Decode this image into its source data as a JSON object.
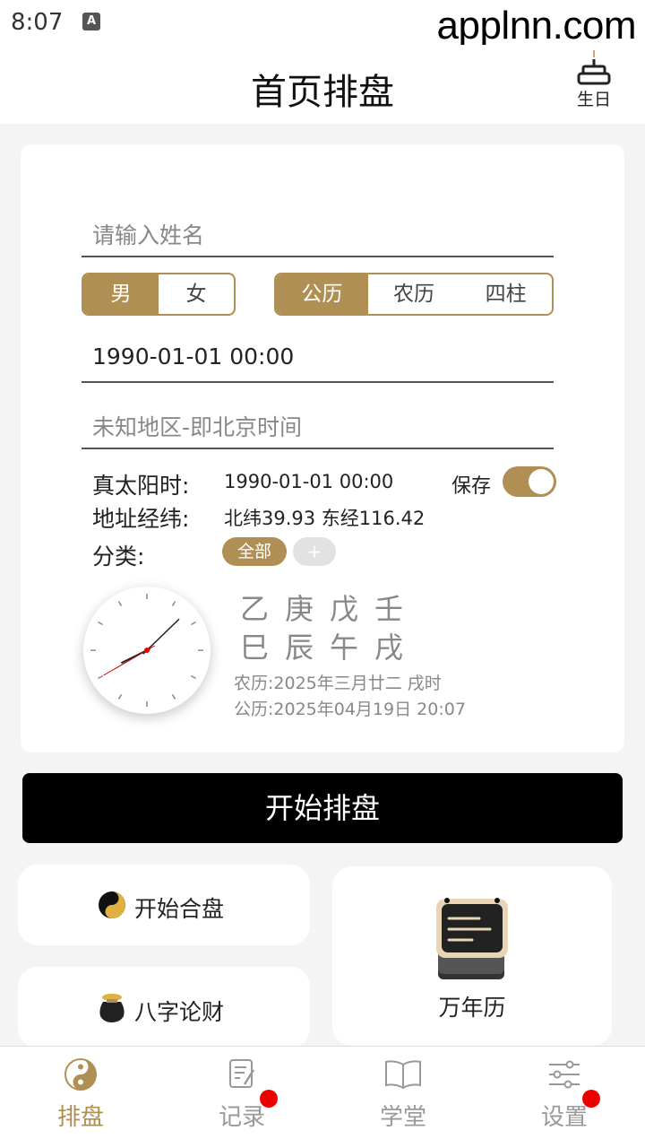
{
  "status": {
    "time": "8:07",
    "notification_icon": "A",
    "watermark": "applnn.com"
  },
  "header": {
    "title": "首页排盘",
    "birthday_label": "生日"
  },
  "form": {
    "name_placeholder": "请输入姓名",
    "gender": {
      "options": [
        "男",
        "女"
      ],
      "selected": "男"
    },
    "calendar": {
      "options": [
        "公历",
        "农历",
        "四柱"
      ],
      "selected": "公历"
    },
    "datetime_value": "1990-01-01 00:00",
    "location_placeholder": "未知地区-即北京时间"
  },
  "info": {
    "solar_time_label": "真太阳时:",
    "solar_time_value": "1990-01-01 00:00",
    "save_label": "保存",
    "save_on": true,
    "coords_label": "地址经纬:",
    "coords_value": "北纬39.93 东经116.42",
    "category_label": "分类:",
    "category_all": "全部",
    "category_add": "+"
  },
  "ganzhi": {
    "stems": "乙庚戊壬",
    "branches": "巳辰午戌",
    "lunar_line": "农历:2025年三月廿二 戌时",
    "solar_line": "公历:2025年04月19日 20:07"
  },
  "clock": {
    "hour": 20,
    "minute": 7,
    "second": 40
  },
  "start_button": "开始排盘",
  "features": {
    "hepan": "开始合盘",
    "lucai": "八字论财",
    "wannianli": "万年历"
  },
  "nav": {
    "items": [
      {
        "label": "排盘",
        "icon": "yinyang-icon",
        "badge": false
      },
      {
        "label": "记录",
        "icon": "notes-icon",
        "badge": true
      },
      {
        "label": "学堂",
        "icon": "book-icon",
        "badge": false
      },
      {
        "label": "设置",
        "icon": "sliders-icon",
        "badge": true
      }
    ],
    "active": "排盘"
  },
  "colors": {
    "accent": "#b08f54",
    "badge": "#ee0000"
  }
}
